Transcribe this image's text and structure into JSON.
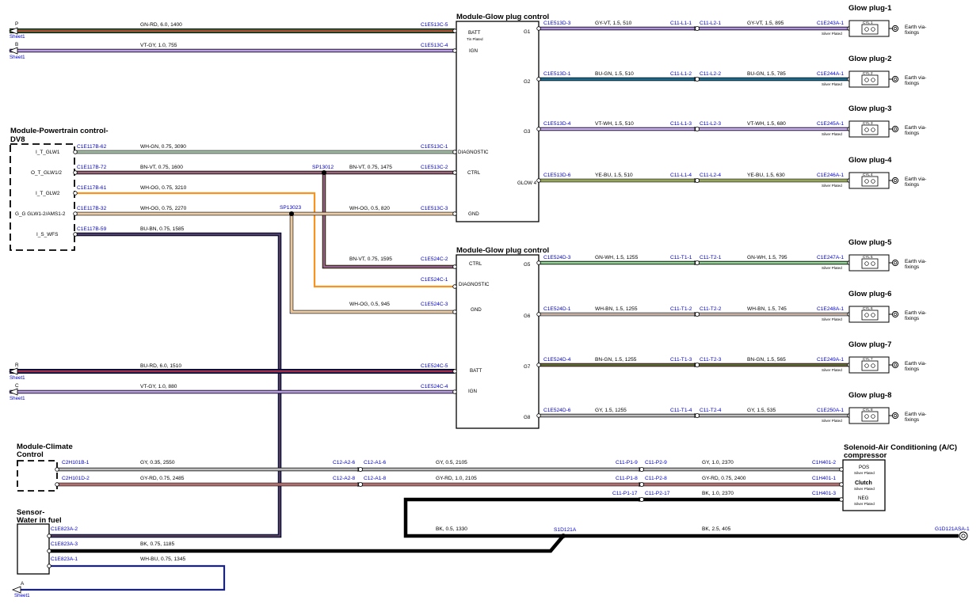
{
  "modules": {
    "glow_a": {
      "title": "Module-Glow plug control"
    },
    "glow_b": {
      "title": "Module-Glow plug control"
    },
    "pcm": {
      "title": "Module-Powertrain control-",
      "title2": "DV8"
    },
    "climate": {
      "title": "Module-Climate",
      "title2": "Control"
    },
    "sensor": {
      "title": "Sensor-",
      "title2": "Water in fuel"
    },
    "solenoid": {
      "title": "Solenoid-Air Conditioning (A/C)",
      "title2": "compressor"
    }
  },
  "modA_pins": {
    "batt": "BATT",
    "tin": "Tin Plated",
    "ign": "IGN",
    "diag": "DIAGNOSTIC",
    "ctrl": "CTRL",
    "gnd": "GND",
    "g1": "G1",
    "g2": "G2",
    "g3": "G3",
    "glow4": "GLOW 4"
  },
  "modB_pins": {
    "ctrl": "CTRL",
    "diag": "DIAGNOSTIC",
    "gnd": "GND",
    "batt": "BATT",
    "ign": "IGN",
    "g5": "G5",
    "g6": "G6",
    "g7": "G7",
    "g8": "G8"
  },
  "pcm_pins": [
    "I_T_GLW1",
    "O_T_GLW1/2",
    "I_T_GLW2",
    "G_G GLW1-2/AMS1-2",
    "I_S_WFS"
  ],
  "sheet": {
    "label": "Sheet1",
    "p": "P",
    "b": "B",
    "r": "R",
    "c": "C",
    "a": "A"
  },
  "splices": {
    "sp1": "SP13012",
    "sp2": "SP13023"
  },
  "left_wires": {
    "p": {
      "conn": "C1E513C-5",
      "wire": "GN-RD,  6.0,  1400",
      "color": "#2e7d32",
      "stripe": "#d32f2f"
    },
    "b": {
      "conn": "C1E513C-4",
      "wire": "VT-GY,  1.0,  755",
      "color": "#9c6fe0",
      "stripe": "#bdbdbd"
    },
    "r": {
      "conn": "C1E524C-5",
      "wire": "BU-RD,  6.0,  1510",
      "color": "#1a237e",
      "stripe": "#d32f2f"
    },
    "c": {
      "conn": "C1E524C-4",
      "wire": "VT-GY,  1.0,  880",
      "color": "#9c6fe0",
      "stripe": "#bdbdbd"
    }
  },
  "pcm_wires": {
    "w1": {
      "from": "C1E117B-62",
      "wire": "WH-GN,  0.75,  3090",
      "to": "C1E513C-1",
      "color": "#ffffff",
      "stripe": "#2e7d32"
    },
    "w2a": {
      "from": "C1E117B-72",
      "wire": "BN-VT,  0.75,  1600",
      "color": "#8d5a3b",
      "stripe": "#9c6fe0"
    },
    "w2b": {
      "wire": "BN-VT,  0.75,  1475",
      "to": "C1E513C-2"
    },
    "w3": {
      "from": "C1E117B-61",
      "wire": "WH-OG,  0.75,  3210",
      "color": "#ffffff",
      "stripe": "#f7931e"
    },
    "w4a": {
      "from": "C1E117B-32",
      "wire": "WH-OG,  0.75,  2270"
    },
    "w4b": {
      "wire": "WH-OG,  0.5,  820",
      "to": "C1E513C-3"
    },
    "w5": {
      "from": "C1E117B-59",
      "wire": "BU-BN,  0.75,  1585",
      "color": "#1a237e",
      "stripe": "#8d5a3b"
    },
    "m2ctrl": {
      "wire": "BN-VT,  0.75,  1595",
      "to": "C1E524C-2"
    },
    "m2diag": {
      "to": "C1E524C-1",
      "color": "#f7931e"
    },
    "m2gnd": {
      "wire": "WH-OG,  0.5,  945",
      "to": "C1E524C-3"
    }
  },
  "glow_rows": [
    {
      "name": "Glow plug-1",
      "cyl": "CYL 1",
      "mconn": "C1E513D-3",
      "w1": "GY-VT,  1.5,  510",
      "s1": "C11-L1-1",
      "s2": "C11-L2-1",
      "w2": "GY-VT,  1.5,  895",
      "plug": "C1E243A-1",
      "color": "#9c6fe0",
      "stripe": "#bdbdbd"
    },
    {
      "name": "Glow plug-2",
      "cyl": "CYL 2",
      "mconn": "C1E513D-1",
      "w1": "BU-GN,  1.5,  510",
      "s1": "C11-L1-2",
      "s2": "C11-L2-2",
      "w2": "BU-GN,  1.5,  785",
      "plug": "C1E244A-1",
      "color": "#1565c0",
      "stripe": "#2e7d32"
    },
    {
      "name": "Glow plug-3",
      "cyl": "CYL 3",
      "mconn": "C1E513D-4",
      "w1": "VT-WH,  1.5,  510",
      "s1": "C11-L1-3",
      "s2": "C11-L2-3",
      "w2": "VT-WH,  1.5,  680",
      "plug": "C1E245A-1",
      "color": "#9c6fe0",
      "stripe": "#ffffff"
    },
    {
      "name": "Glow plug-4",
      "cyl": "CYL 4",
      "mconn": "C1E513D-6",
      "w1": "YE-BU,  1.5,  510",
      "s1": "C11-L1-4",
      "s2": "C11-L2-4",
      "w2": "YE-BU,  1.5,  630",
      "plug": "C1E246A-1",
      "color": "#f5e642",
      "stripe": "#1565c0"
    },
    {
      "name": "Glow plug-5",
      "cyl": "CYL 5",
      "mconn": "C1E524D-3",
      "w1": "GN-WH,  1.5,  1255",
      "s1": "C11-T1-1",
      "s2": "C11-T2-1",
      "w2": "GN-WH,  1.5,  795",
      "plug": "C1E247A-1",
      "color": "#43a047",
      "stripe": "#ffffff"
    },
    {
      "name": "Glow plug-6",
      "cyl": "CYL 6",
      "mconn": "C1E524D-1",
      "w1": "WH-BN,  1.5,  1255",
      "s1": "C11-T1-2",
      "s2": "C11-T2-2",
      "w2": "WH-BN,  1.5,  745",
      "plug": "C1E248A-1",
      "color": "#ffffff",
      "stripe": "#8d5a3b"
    },
    {
      "name": "Glow plug-7",
      "cyl": "CYL 7",
      "mconn": "C1E524D-4",
      "w1": "BN-GN,  1.5,  1255",
      "s1": "C11-T1-3",
      "s2": "C11-T2-3",
      "w2": "BN-GN,  1.5,  565",
      "plug": "C1E249A-1",
      "color": "#8d5a3b",
      "stripe": "#2e7d32"
    },
    {
      "name": "Glow plug-8",
      "cyl": "CYL 8",
      "mconn": "C1E524D-6",
      "w1": "GY,  1.5,  1255",
      "s1": "C11-T1-4",
      "s2": "C11-T2-4",
      "w2": "GY,  1.5,  535",
      "plug": "C1E250A-1",
      "color": "#bdbdbd",
      "stripe": "#bdbdbd"
    }
  ],
  "silver": "Silver Plated",
  "earth": {
    "line1": "Earth via-",
    "line2": "fixings"
  },
  "climate": {
    "gy": {
      "c1": "C2H101B-1",
      "w1": "GY,  0.35,  2550",
      "j1": "C12-A2-6",
      "j2": "C12-A1-6",
      "w2": "GY,  0.5,  2105",
      "k1": "C11-P1-9",
      "k2": "C11-P2-9",
      "w3": "GY,  1.0,  2370",
      "end": "C1H401-2",
      "color": "#bdbdbd"
    },
    "gyrd": {
      "c1": "C2H101D-2",
      "w1": "GY-RD,  0.75,  2485",
      "j1": "C12-A2-8",
      "j2": "C12-A1-8",
      "w2": "GY-RD,  1.0,  2105",
      "k1": "C11-P1-8",
      "k2": "C11-P2-8",
      "w3": "GY-RD,  0.75,  2400",
      "end": "C1H401-1",
      "color": "#bdbdbd",
      "stripe": "#d32f2f"
    },
    "bk": {
      "k1": "C11-P1-17",
      "k2": "C11-P2-17",
      "w3": "BK,  1.0,  2370",
      "end": "C1H401-3"
    }
  },
  "solenoid_pins": {
    "pos": "POS",
    "clutch": "Clutch",
    "neg": "NEG"
  },
  "ground": {
    "bk1": "BK,  0.5,  1330",
    "bk2": "BK,  2.5,  405",
    "splice": "S1D121A",
    "end": "G1D121ASA-1"
  },
  "sensor": {
    "c2": "C1E823A-2",
    "c3": "C1E823A-3",
    "w3": "BK,  0.75,  1185",
    "c1": "C1E823A-1",
    "w1": "WH-BU,  0.75,  1345"
  }
}
